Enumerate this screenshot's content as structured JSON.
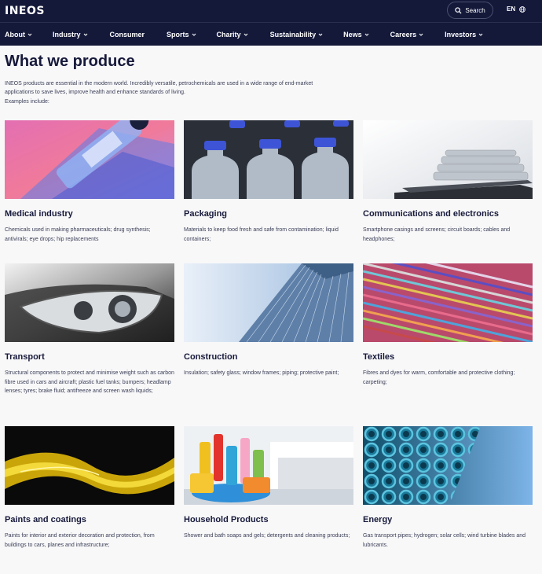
{
  "header": {
    "logo": "INEOS",
    "search_label": "Search",
    "lang_label": "EN"
  },
  "nav": [
    {
      "label": "About",
      "chevron": true
    },
    {
      "label": "Industry",
      "chevron": true
    },
    {
      "label": "Consumer",
      "chevron": false
    },
    {
      "label": "Sports",
      "chevron": true
    },
    {
      "label": "Charity",
      "chevron": true
    },
    {
      "label": "Sustainability",
      "chevron": true
    },
    {
      "label": "News",
      "chevron": true
    },
    {
      "label": "Careers",
      "chevron": true
    },
    {
      "label": "Investors",
      "chevron": true
    }
  ],
  "main": {
    "title": "What we produce",
    "intro": "INEOS products are essential in the modern world. Incredibly versatile, petrochemicals are used in a wide range of end-market applications to save lives, improve health and enhance standards of living.",
    "examples_label": "Examples include:",
    "cards": [
      {
        "title": "Medical industry",
        "desc": "Chemicals used in making pharmaceuticals; drug synthesis; antivirals; eye drops; hip replacements"
      },
      {
        "title": "Packaging",
        "desc": "Materials to keep food fresh and safe from contamination; liquid containers;"
      },
      {
        "title": "Communications and electronics",
        "desc": "Smartphone casings and screens; circuit boards; cables and headphones;"
      },
      {
        "title": "Transport",
        "desc": "Structural components to protect and minimise weight such as carbon fibre used in cars and aircraft; plastic fuel tanks; bumpers; headlamp lenses; tyres; brake fluid; antifreeze and screen wash liquids;"
      },
      {
        "title": "Construction",
        "desc": "Insulation; safety glass; window frames; piping; protective paint;"
      },
      {
        "title": "Textiles",
        "desc": "Fibres and dyes for warm, comfortable and protective clothing; carpeting;"
      },
      {
        "title": "Paints and coatings",
        "desc": "Paints for interior and exterior decoration and protection, from buildings to cars, planes and infrastructure;"
      },
      {
        "title": "Household Products",
        "desc": "Shower and bath soaps and gels; detergents and cleaning products;"
      },
      {
        "title": "Energy",
        "desc": "Gas transport pipes; hydrogen; solar cells; wind turbine blades and lubricants."
      }
    ]
  },
  "colors": {
    "header_bg": "#14193a",
    "page_bg": "#f8f8f9",
    "heading_text": "#16193a"
  }
}
